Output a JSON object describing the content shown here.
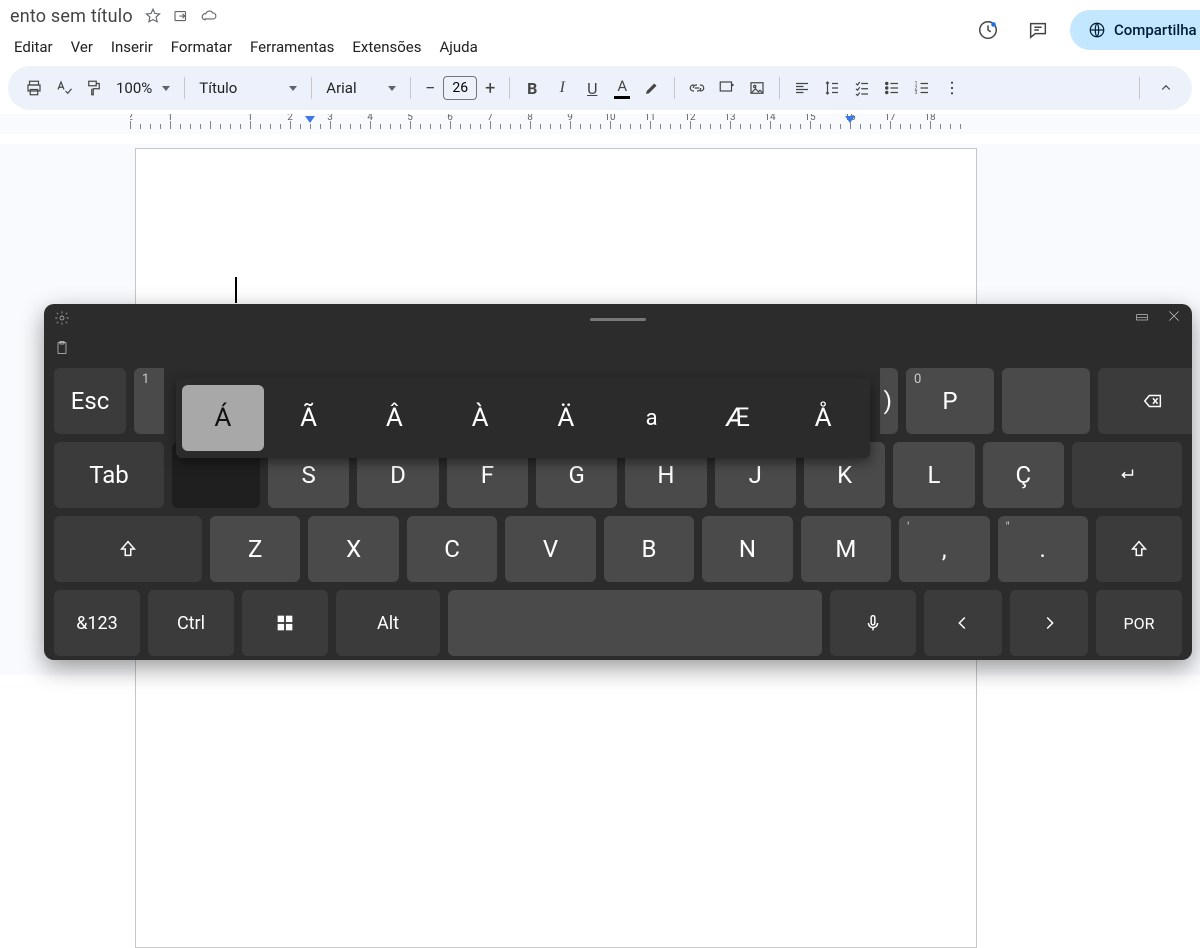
{
  "header": {
    "title": "ento sem título",
    "share_label": "Compartilha"
  },
  "menus": [
    "Editar",
    "Ver",
    "Inserir",
    "Formatar",
    "Ferramentas",
    "Extensões",
    "Ajuda"
  ],
  "toolbar": {
    "zoom": "100%",
    "style": "Título",
    "font": "Arial",
    "font_size": "26"
  },
  "ruler": {
    "labels": [
      "2",
      "1",
      "",
      "1",
      "2",
      "3",
      "4",
      "5",
      "6",
      "7",
      "8",
      "9",
      "10",
      "11",
      "12",
      "13",
      "14",
      "15",
      "16",
      "17",
      "18"
    ]
  },
  "osk": {
    "row1": {
      "esc": "Esc",
      "sup1": "1",
      "sup0": "0",
      "p": "P"
    },
    "accents": [
      "Á",
      "Ã",
      "Â",
      "À",
      "Ä",
      "a",
      "Æ",
      "Å"
    ],
    "row2": {
      "tab": "Tab",
      "keys": [
        "S",
        "D",
        "F",
        "G",
        "H",
        "J",
        "K",
        "L",
        "Ç"
      ]
    },
    "row3": {
      "keys": [
        "Z",
        "X",
        "C",
        "V",
        "B",
        "N",
        "M"
      ],
      "sup_comma": "'",
      "comma": ",",
      "sup_quote": "\"",
      "dot": "."
    },
    "row4": {
      "fn": "&123",
      "ctrl": "Ctrl",
      "alt": "Alt",
      "lang": "POR"
    }
  }
}
